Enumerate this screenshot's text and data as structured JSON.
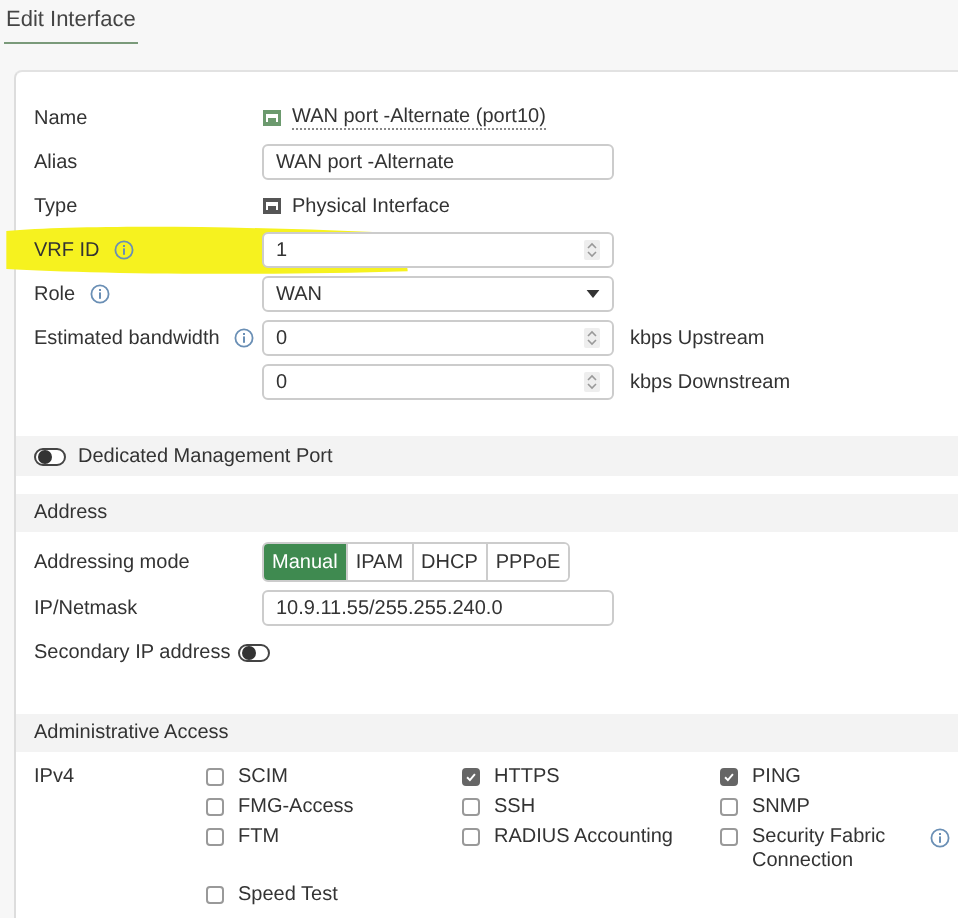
{
  "page_title": "Edit Interface",
  "fields": [
    {
      "label": "Name",
      "info": false,
      "highlighted": false,
      "kind": "link",
      "value": "WAN port -Alternate (port10)"
    },
    {
      "label": "Alias",
      "info": false,
      "highlighted": false,
      "kind": "input",
      "value": "WAN port -Alternate"
    },
    {
      "label": "Type",
      "info": false,
      "highlighted": false,
      "kind": "static",
      "value": "Physical Interface"
    },
    {
      "label": "VRF ID",
      "info": true,
      "highlighted": true,
      "kind": "spinner",
      "value": "1"
    },
    {
      "label": "Role",
      "info": true,
      "highlighted": false,
      "kind": "select",
      "value": "WAN"
    },
    {
      "label": "Estimated bandwidth",
      "info": true,
      "highlighted": false,
      "kind": "spinner",
      "value": "0",
      "unit": "kbps Upstream"
    },
    {
      "info": false,
      "highlighted": false,
      "kind": "spinner",
      "value": "0",
      "unit": "kbps Downstream"
    }
  ],
  "dedicated_port": {
    "label": "Dedicated Management Port",
    "on": false
  },
  "address": {
    "title": "Address",
    "mode": {
      "label": "Addressing mode",
      "options": [
        {
          "label": "Manual",
          "selected": true
        },
        {
          "label": "IPAM",
          "selected": false
        },
        {
          "label": "DHCP",
          "selected": false
        },
        {
          "label": "PPPoE",
          "selected": false
        }
      ]
    },
    "ip": {
      "label": "IP/Netmask",
      "value": "10.9.11.55/255.255.240.0"
    },
    "secondary": {
      "label": "Secondary IP address",
      "on": false
    }
  },
  "admin_access": {
    "title": "Administrative Access",
    "ipv4_label": "IPv4",
    "options": [
      {
        "label": "SCIM",
        "checked": false,
        "info": false
      },
      {
        "label": "HTTPS",
        "checked": true,
        "info": false
      },
      {
        "label": "PING",
        "checked": true,
        "info": false
      },
      {
        "label": "FMG-Access",
        "checked": false,
        "info": false
      },
      {
        "label": "SSH",
        "checked": false,
        "info": false
      },
      {
        "label": "SNMP",
        "checked": false,
        "info": false
      },
      {
        "label": "FTM",
        "checked": false,
        "info": false
      },
      {
        "label": "RADIUS Accounting",
        "checked": false,
        "info": false
      },
      {
        "label": "Security Fabric Connection",
        "checked": false,
        "info": true
      },
      {
        "label": "Speed Test",
        "checked": false,
        "info": false
      }
    ]
  }
}
